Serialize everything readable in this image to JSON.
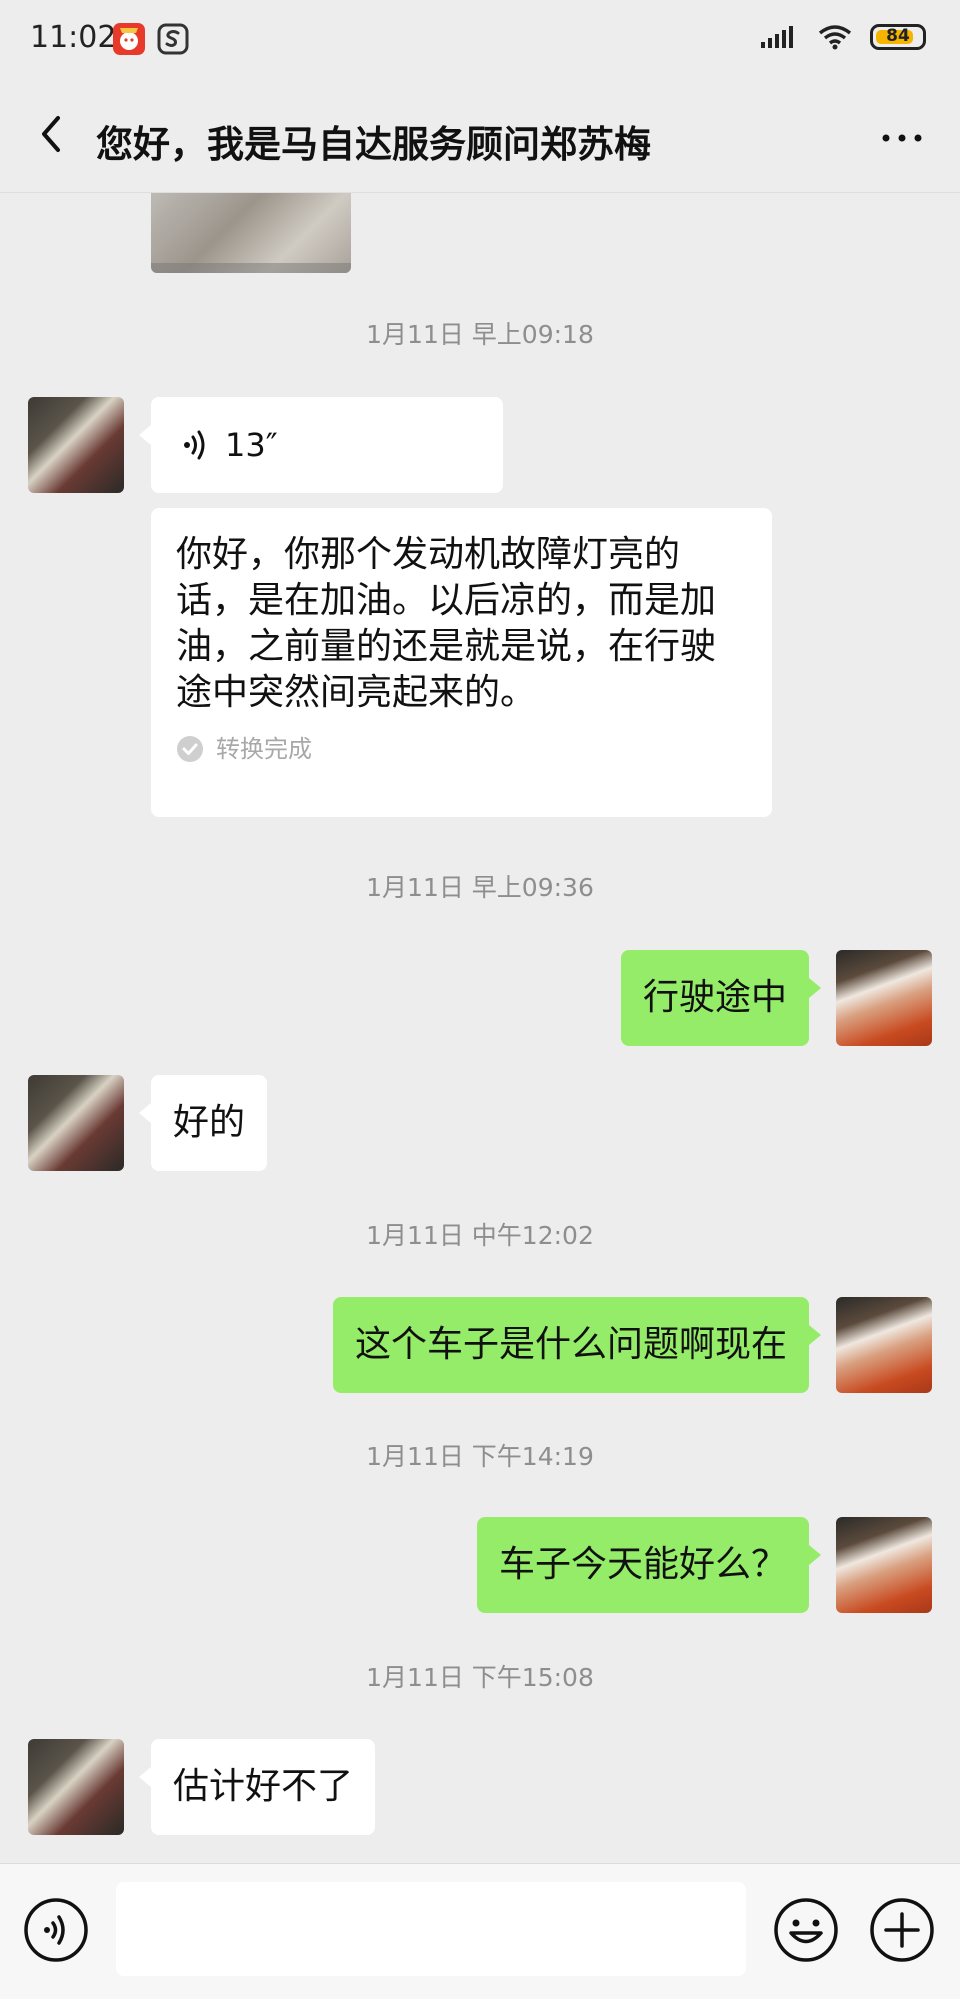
{
  "status_bar": {
    "time": "11:02",
    "battery": "84",
    "battery_level": 0.84
  },
  "header": {
    "title": "您好，我是马自达服务顾问郑苏梅"
  },
  "messages": {
    "ts1": "1月11日 早上09:18",
    "voice_duration": "13″",
    "transcript": "你好，你那个发动机故障灯亮的话，是在加油。以后凉的，而是加油，之前量的还是就是说，在行驶途中突然间亮起来的。",
    "convert_status": "转换完成",
    "ts2": "1月11日 早上09:36",
    "out1": "行驶途中",
    "in1": "好的",
    "ts3": "1月11日 中午12:02",
    "out2": "这个车子是什么问题啊现在",
    "ts4": "1月11日 下午14:19",
    "out3": "车子今天能好么？",
    "ts5": "1月11日 下午15:08",
    "in2": "估计好不了"
  },
  "input": {
    "value": ""
  },
  "colors": {
    "chat_bg": "#ededed",
    "outgoing_bubble": "#95ec69",
    "incoming_bubble": "#ffffff",
    "battery_fill": "#f5b400"
  },
  "icons": [
    "back-arrow-icon",
    "more-icon",
    "voice-icon",
    "emoji-icon",
    "plus-icon",
    "signal-icon",
    "wifi-icon",
    "battery-icon",
    "check-icon",
    "voice-wave-icon"
  ]
}
